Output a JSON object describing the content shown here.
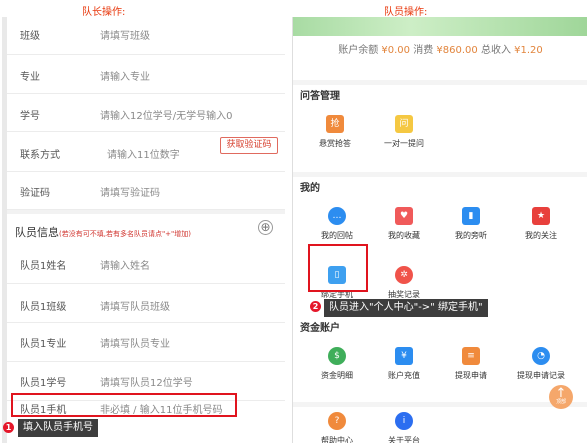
{
  "captions": {
    "left": "队长操作:",
    "right": "队员操作:"
  },
  "left": {
    "rows": [
      {
        "label": "班级",
        "value": "请填写班级"
      },
      {
        "label": "专业",
        "value": "请输入专业"
      },
      {
        "label": "学号",
        "value": "请输入12位学号/无学号输入0"
      },
      {
        "label": "联系方式",
        "value": "请输入11位数字",
        "button": "获取验证码"
      },
      {
        "label": "验证码",
        "value": "请填写验证码"
      }
    ],
    "section": {
      "title": "队员信息",
      "hint": "(若没有可不填,若有多名队员请点\"+\"增加)",
      "add": "⊕"
    },
    "members": [
      {
        "label": "队员1姓名",
        "value": "请输入姓名"
      },
      {
        "label": "队员1班级",
        "value": "请填写队员班级"
      },
      {
        "label": "队员1专业",
        "value": "请填写队员专业"
      },
      {
        "label": "队员1学号",
        "value": "请填写队员12位学号"
      },
      {
        "label": "队员1手机",
        "value": "非必填 / 输入11位手机号码"
      }
    ],
    "annotation": {
      "num": "1",
      "text": "填入队员手机号"
    }
  },
  "right": {
    "balance": {
      "prefix": "账户余额",
      "balance": "¥0.00",
      "spend_label": "消费",
      "spend": "¥860.00",
      "income_label": "总收入",
      "income": "¥1.20"
    },
    "qa": {
      "title": "问答管理",
      "items": [
        {
          "label": "悬赏抢答",
          "icon": "抢",
          "icon_name": "grab-answer-icon",
          "color": "#f08a3c"
        },
        {
          "label": "一对一提问",
          "icon": "问",
          "icon_name": "one-on-one-question-icon",
          "color": "#f5c842"
        }
      ]
    },
    "mine": {
      "title": "我的",
      "items": [
        {
          "label": "我的回帖",
          "icon": "…",
          "icon_name": "reply-bubble-icon",
          "color": "#2c8df0",
          "circle": true
        },
        {
          "label": "我的收藏",
          "icon": "♥",
          "icon_name": "favorite-heart-icon",
          "color": "#f05a5a"
        },
        {
          "label": "我的旁听",
          "icon": "▮",
          "icon_name": "audit-book-icon",
          "color": "#2c8df0"
        },
        {
          "label": "我的关注",
          "icon": "★",
          "icon_name": "follow-star-icon",
          "color": "#e8403c"
        },
        {
          "label": "绑定手机",
          "icon": "▯",
          "icon_name": "phone-bind-icon",
          "color": "#3ea0f0"
        },
        {
          "label": "抽奖记录",
          "icon": "✲",
          "icon_name": "lottery-record-icon",
          "color": "#f0534a",
          "circle": true
        }
      ]
    },
    "annotation": {
      "num": "2",
      "text": "队员进入\"个人中心\"->\" 绑定手机\""
    },
    "funds": {
      "title": "资金账户",
      "items": [
        {
          "label": "资金明细",
          "icon": "$",
          "icon_name": "money-bag-icon",
          "color": "#3fae5a",
          "circle": true
        },
        {
          "label": "账户充值",
          "icon": "¥",
          "icon_name": "recharge-icon",
          "color": "#2c8df0"
        },
        {
          "label": "提现申请",
          "icon": "≡",
          "icon_name": "withdraw-request-icon",
          "color": "#f08a3c"
        },
        {
          "label": "提现申请记录",
          "icon": "◔",
          "icon_name": "withdraw-record-icon",
          "color": "#2c8df0",
          "circle": true
        }
      ]
    },
    "more": {
      "items": [
        {
          "label": "帮助中心",
          "icon": "?",
          "icon_name": "help-center-icon",
          "color": "#f08a3c",
          "circle": true
        },
        {
          "label": "关于平台",
          "icon": "i",
          "icon_name": "about-platform-icon",
          "color": "#2c6ef0",
          "circle": true
        }
      ]
    },
    "top_button": {
      "arrow": "↑",
      "label": "顶部"
    }
  }
}
